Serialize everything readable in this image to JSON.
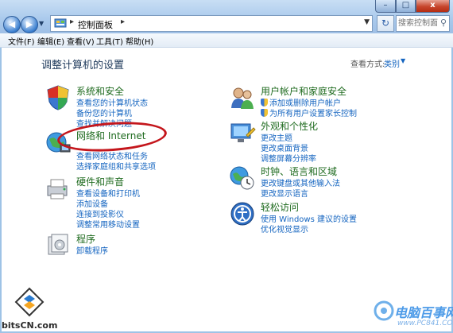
{
  "window": {
    "caption_buttons": {
      "minimize": "–",
      "maximize": "□",
      "close": "x"
    }
  },
  "address_bar": {
    "breadcrumb": "控制面板",
    "separator": "▸",
    "refresh_glyph": "↻",
    "search_placeholder": "搜索控制面板",
    "search_icon": "search-icon"
  },
  "menu": [
    "文件(F)",
    "编辑(E)",
    "查看(V)",
    "工具(T)",
    "帮助(H)"
  ],
  "main": {
    "title": "调整计算机的设置",
    "view_by_label": "查看方式:",
    "view_by_value": "类别",
    "view_by_dropdown": "▼"
  },
  "categories_left": [
    {
      "icon": "security-shield-icon",
      "heading": "系统和安全",
      "links": [
        "查看您的计算机状态",
        "备份您的计算机",
        "查找并解决问题"
      ]
    },
    {
      "icon": "network-globe-icon",
      "heading": "网络和 Internet",
      "links": [
        "查看网络状态和任务",
        "选择家庭组和共享选项"
      ]
    },
    {
      "icon": "printer-icon",
      "heading": "硬件和声音",
      "links": [
        "查看设备和打印机",
        "添加设备",
        "连接到投影仪",
        "调整常用移动设置"
      ]
    },
    {
      "icon": "programs-icon",
      "heading": "程序",
      "links": [
        "卸载程序"
      ]
    }
  ],
  "categories_right": [
    {
      "icon": "user-accounts-icon",
      "heading": "用户帐户和家庭安全",
      "links": [
        "添加或删除用户帐户",
        "为所有用户设置家长控制"
      ]
    },
    {
      "icon": "appearance-icon",
      "heading": "外观和个性化",
      "links": [
        "更改主题",
        "更改桌面背景",
        "调整屏幕分辨率"
      ]
    },
    {
      "icon": "clock-globe-icon",
      "heading": "时钟、语言和区域",
      "links": [
        "更改键盘或其他输入法",
        "更改显示语言"
      ]
    },
    {
      "icon": "ease-of-access-icon",
      "heading": "轻松访问",
      "links": [
        "使用 Windows 建议的设置",
        "优化视觉显示"
      ]
    }
  ],
  "watermarks": {
    "left": "bitsCN.com",
    "right_big": "电脑百事网",
    "right_small": "www.PC841.COM"
  },
  "colors": {
    "heading_green": "#1f6b1f",
    "link_blue": "#1565c0",
    "highlight_oval": "#c4161c"
  }
}
